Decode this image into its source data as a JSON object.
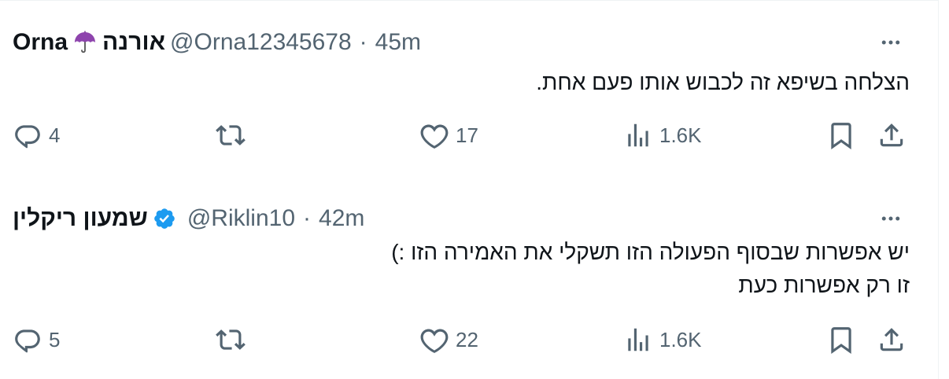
{
  "tweets": [
    {
      "display_name": "Orna",
      "emoji": "umbrella-emoji",
      "name_hebrew": "אורנה",
      "verified": false,
      "handle": "@Orna12345678",
      "separator": "·",
      "time": "45m",
      "text_lines": [
        "הצלחה בשיפא זה לכבוש אותו פעם אחת."
      ],
      "counts": {
        "replies": "4",
        "retweets": "",
        "likes": "17",
        "views": "1.6K"
      }
    },
    {
      "display_name": "שמעון ריקלין",
      "verified": true,
      "handle": "@Riklin10",
      "separator": "·",
      "time": "42m",
      "text_lines": [
        "יש אפשרות שבסוף הפעולה הזו תשקלי את האמירה הזו :)",
        "זו רק אפשרות כעת"
      ],
      "counts": {
        "replies": "5",
        "retweets": "",
        "likes": "22",
        "views": "1.6K"
      }
    }
  ],
  "colors": {
    "text": "#0f1419",
    "secondary": "#536471",
    "verified": "#1d9bf0",
    "divider": "#eff3f4",
    "umbrella": "#8e44ad"
  },
  "icons": [
    "more-icon",
    "reply-icon",
    "retweet-icon",
    "like-icon",
    "views-icon",
    "bookmark-icon",
    "share-icon"
  ]
}
